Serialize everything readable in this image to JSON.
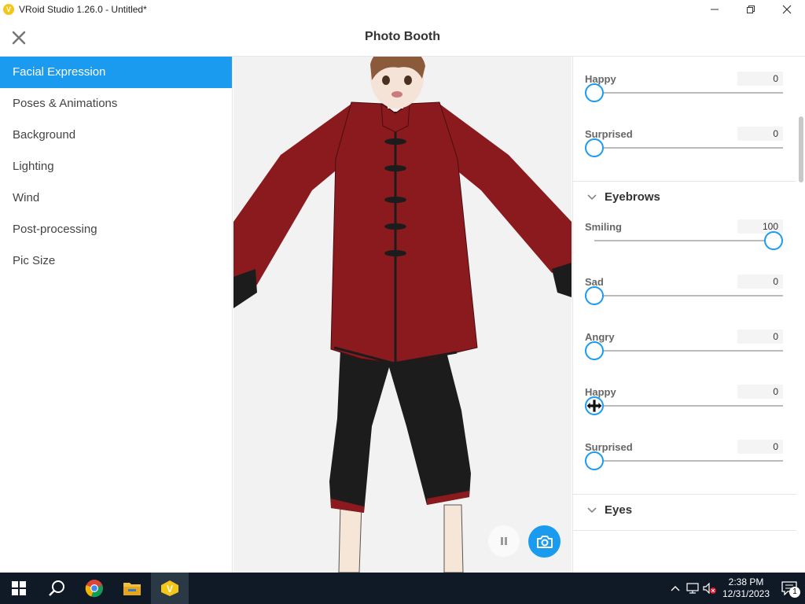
{
  "window": {
    "title": "VRoid Studio 1.26.0 - Untitled*",
    "minimize": "—",
    "maximize": "❐",
    "close": "✕"
  },
  "header": {
    "title": "Photo Booth"
  },
  "sidebar": {
    "items": [
      {
        "label": "Facial Expression",
        "active": true
      },
      {
        "label": "Poses & Animations"
      },
      {
        "label": "Background"
      },
      {
        "label": "Lighting"
      },
      {
        "label": "Wind"
      },
      {
        "label": "Post-processing"
      },
      {
        "label": "Pic Size"
      }
    ]
  },
  "panel": {
    "mouth_sliders": [
      {
        "label": "Happy",
        "value": "0",
        "level": 0
      },
      {
        "label": "Surprised",
        "value": "0",
        "level": 0
      }
    ],
    "eyebrows": {
      "title": "Eyebrows",
      "sliders": [
        {
          "label": "Smiling",
          "value": "100",
          "level": 100
        },
        {
          "label": "Sad",
          "value": "0",
          "level": 0
        },
        {
          "label": "Angry",
          "value": "0",
          "level": 0
        },
        {
          "label": "Happy",
          "value": "0",
          "level": 0
        },
        {
          "label": "Surprised",
          "value": "0",
          "level": 0
        }
      ]
    },
    "eyes": {
      "title": "Eyes"
    }
  },
  "colors": {
    "accent": "#1a9bf0",
    "jacket": "#8b1a1f",
    "taskbar": "#0f1a26"
  },
  "taskbar": {
    "time": "2:38 PM",
    "date": "12/31/2023",
    "notification_count": "1"
  }
}
